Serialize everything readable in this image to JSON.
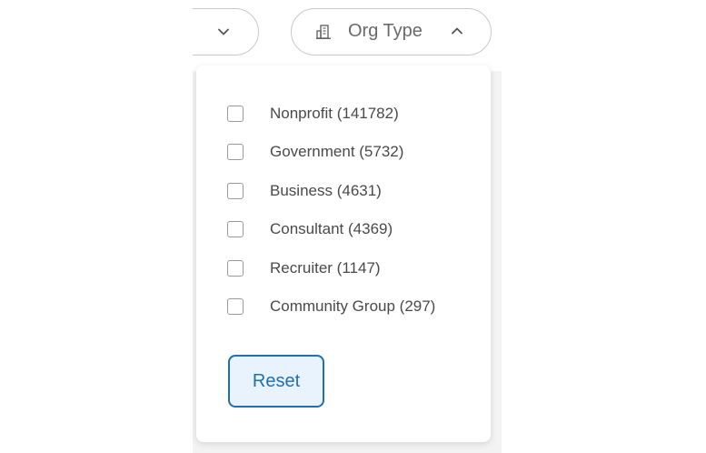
{
  "filters": {
    "left_pill": {
      "partial_text": "s",
      "icon": "chevron-down-icon"
    },
    "org_type": {
      "label": "Org Type",
      "icon": "building-icon",
      "toggle_icon": "chevron-up-icon",
      "expanded": true
    }
  },
  "dropdown": {
    "options": [
      {
        "label": "Nonprofit (141782)",
        "checked": false
      },
      {
        "label": "Government (5732)",
        "checked": false
      },
      {
        "label": "Business (4631)",
        "checked": false
      },
      {
        "label": "Consultant (4369)",
        "checked": false
      },
      {
        "label": "Recruiter (1147)",
        "checked": false
      },
      {
        "label": "Community Group (297)",
        "checked": false
      }
    ],
    "reset_label": "Reset"
  },
  "colors": {
    "accent": "#1f6fb2",
    "accent_bg": "#e8f3fd",
    "border": "#c9c9c9",
    "text": "#4a4a4a"
  }
}
